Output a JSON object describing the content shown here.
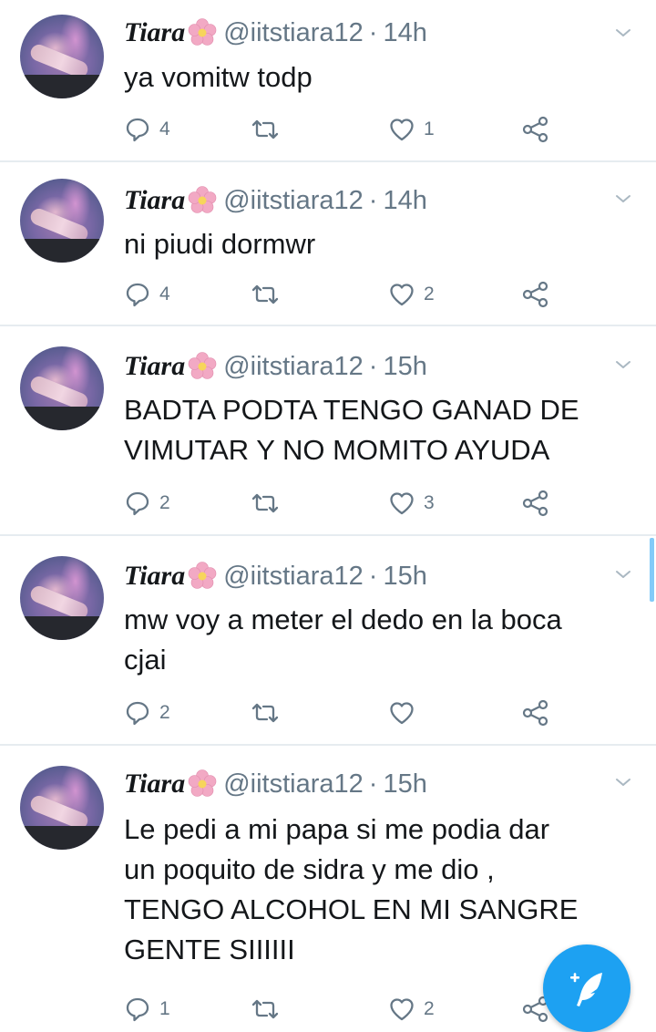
{
  "tweets": [
    {
      "name": "Tiara",
      "handle": "@iitstiara12",
      "time": "14h",
      "lines": [
        "ya vomitw todp"
      ],
      "replies": "4",
      "retweets": "",
      "likes": "1"
    },
    {
      "name": "Tiara",
      "handle": "@iitstiara12",
      "time": "14h",
      "lines": [
        "ni piudi dormwr"
      ],
      "replies": "4",
      "retweets": "",
      "likes": "2"
    },
    {
      "name": "Tiara",
      "handle": "@iitstiara12",
      "time": "15h",
      "lines": [
        "BADTA PODTA TENGO GANAD DE",
        "VIMUTAR Y NO MOMITO AYUDA"
      ],
      "replies": "2",
      "retweets": "",
      "likes": "3"
    },
    {
      "name": "Tiara",
      "handle": "@iitstiara12",
      "time": "15h",
      "lines": [
        "mw voy a meter el dedo en la boca",
        "cjai"
      ],
      "replies": "2",
      "retweets": "",
      "likes": ""
    },
    {
      "name": "Tiara",
      "handle": "@iitstiara12",
      "time": "15h",
      "lines": [
        "Le pedi a mi papa si me podia dar",
        "un poquito de sidra y me dio ,",
        "TENGO ALCOHOL EN MI SANGRE",
        "GENTE SIIIIII"
      ],
      "replies": "1",
      "retweets": "",
      "likes": "2"
    }
  ],
  "separator": "·",
  "icons": {
    "reply": "reply-icon",
    "retweet": "retweet-icon",
    "like": "like-icon",
    "share": "share-icon",
    "menu": "chevron-down-icon",
    "emoji": "cherry-blossom-icon",
    "compose": "compose-tweet-icon"
  },
  "colors": {
    "accent": "#1da1f2",
    "muted": "#657786",
    "text": "#14171a",
    "divider": "#e6ecf0"
  }
}
